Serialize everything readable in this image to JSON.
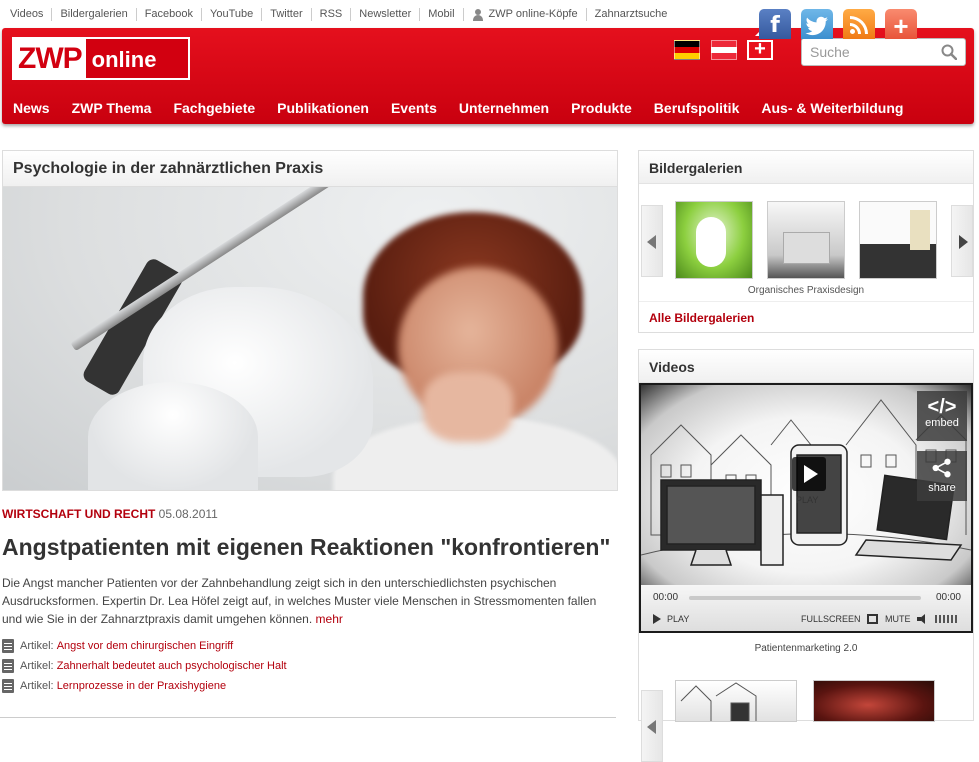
{
  "utility_links": [
    "Videos",
    "Bildergalerien",
    "Facebook",
    "YouTube",
    "Twitter",
    "RSS",
    "Newsletter",
    "Mobil",
    "ZWP online-Köpfe",
    "Zahnarztsuche"
  ],
  "social": {
    "facebook": "f",
    "twitter": "t",
    "rss": ")))",
    "plus": "+"
  },
  "logo": {
    "zwp": "ZWP",
    "online": "online"
  },
  "flags": [
    "flag-germany",
    "flag-austria",
    "flag-switzerland"
  ],
  "flag_ch_symbol": "+",
  "search": {
    "placeholder": "Suche",
    "icon": "magnifier-icon"
  },
  "nav": [
    "News",
    "ZWP Thema",
    "Fachgebiete",
    "Publikationen",
    "Events",
    "Unternehmen",
    "Produkte",
    "Berufspolitik",
    "Aus- & Weiterbildung"
  ],
  "article": {
    "section_title": "Psychologie in der zahnärztlichen Praxis",
    "category": "WIRTSCHAFT UND RECHT",
    "date": "05.08.2011",
    "title": "Angstpatienten mit eigenen Reaktionen \"konfrontieren\"",
    "teaser": "Die Angst mancher Patienten vor der Zahnbehandlung zeigt sich in den unterschiedlichsten psychischen Ausdrucksformen. Expertin Dr. Lea Höfel zeigt auf, in welches Muster viele Menschen in Stressmomenten fallen und wie Sie in der Zahnarztpraxis damit umgehen können.",
    "more": "mehr",
    "related": [
      {
        "prefix": "Artikel:",
        "title": "Angst vor dem chirurgischen Eingriff"
      },
      {
        "prefix": "Artikel:",
        "title": "Zahnerhalt bedeutet auch psychologischer Halt"
      },
      {
        "prefix": "Artikel:",
        "title": "Lernprozesse in der Praxishygiene"
      }
    ]
  },
  "gallery": {
    "title": "Bildergalerien",
    "caption": "Organisches Praxisdesign",
    "all_link": "Alle Bildergalerien"
  },
  "videos": {
    "title": "Videos",
    "embed_label": "embed",
    "share_label": "share",
    "play_overlay_label": "PLAY",
    "time_current": "00:00",
    "time_duration": "00:00",
    "play_label": "PLAY",
    "fullscreen_label": "FULLSCREEN",
    "mute_label": "MUTE",
    "caption": "Patientenmarketing 2.0"
  },
  "colors": {
    "brand_red": "#d20010",
    "link_red": "#b3000d"
  }
}
